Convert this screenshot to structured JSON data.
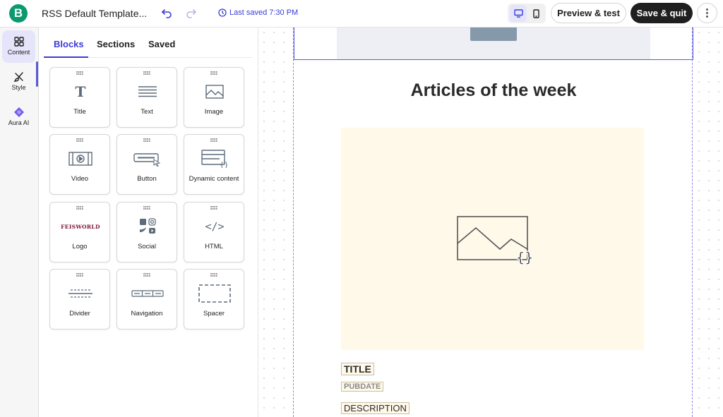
{
  "header": {
    "logo_letter": "B",
    "doc_title": "RSS Default Template...",
    "last_saved": "Last saved 7:30 PM",
    "preview_label": "Preview & test",
    "save_label": "Save & quit",
    "more_label": "⋮"
  },
  "rail": {
    "items": [
      {
        "label": "Content",
        "icon": "grid-icon"
      },
      {
        "label": "Style",
        "icon": "brush-icon"
      },
      {
        "label": "Aura AI",
        "icon": "sparkle-icon"
      }
    ]
  },
  "panel": {
    "tabs": [
      "Blocks",
      "Sections",
      "Saved"
    ],
    "blocks": [
      {
        "label": "Title",
        "icon": "title-icon"
      },
      {
        "label": "Text",
        "icon": "text-icon"
      },
      {
        "label": "Image",
        "icon": "image-icon"
      },
      {
        "label": "Video",
        "icon": "video-icon"
      },
      {
        "label": "Button",
        "icon": "button-icon"
      },
      {
        "label": "Dynamic content",
        "icon": "dynamic-content-icon"
      },
      {
        "label": "Logo",
        "icon": "logo-icon",
        "logo_text": "FEISWORLD"
      },
      {
        "label": "Social",
        "icon": "social-icon"
      },
      {
        "label": "HTML",
        "icon": "html-icon",
        "glyph": "</>"
      },
      {
        "label": "Divider",
        "icon": "divider-icon"
      },
      {
        "label": "Navigation",
        "icon": "navigation-icon"
      },
      {
        "label": "Spacer",
        "icon": "spacer-icon"
      }
    ]
  },
  "canvas": {
    "article_title": "Articles of the week",
    "tags": {
      "title": "TITLE",
      "pubdate": "PUBDATE",
      "description": "DESCRIPTION"
    }
  },
  "colors": {
    "brand": "#0b996e",
    "accent": "#3b3bd8",
    "placeholder_bg": "#fff9ea"
  }
}
